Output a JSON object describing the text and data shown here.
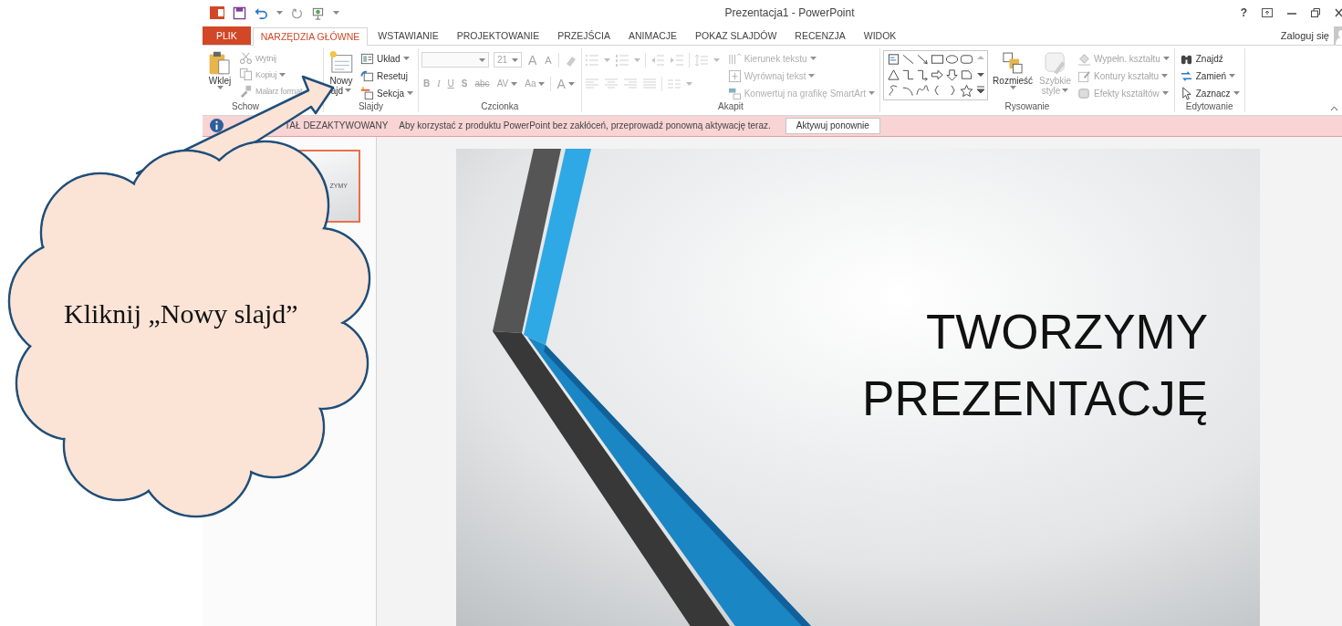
{
  "title_bar": {
    "title": "Prezentacja1 - PowerPoint",
    "help": "?"
  },
  "tabs": [
    {
      "label": "PLIK",
      "kind": "file",
      "selected": false
    },
    {
      "label": "NARZĘDZIA GŁÓWNE",
      "kind": "tab",
      "selected": true
    },
    {
      "label": "WSTAWIANIE",
      "kind": "tab",
      "selected": false
    },
    {
      "label": "PROJEKTOWANIE",
      "kind": "tab",
      "selected": false
    },
    {
      "label": "PRZEJŚCIA",
      "kind": "tab",
      "selected": false
    },
    {
      "label": "ANIMACJE",
      "kind": "tab",
      "selected": false
    },
    {
      "label": "POKAZ SLAJDÓW",
      "kind": "tab",
      "selected": false
    },
    {
      "label": "RECENZJA",
      "kind": "tab",
      "selected": false
    },
    {
      "label": "WIDOK",
      "kind": "tab",
      "selected": false
    }
  ],
  "account": {
    "label": "Zaloguj się"
  },
  "ribbon": {
    "groups": [
      {
        "label": "Schow",
        "kind": "basic",
        "items": [
          {
            "kind": "large",
            "lines": [
              "Wklej"
            ],
            "caret": true,
            "disabled": false
          },
          {
            "kind": "small",
            "lines": [
              "Wytnij"
            ],
            "caret": false,
            "disabled": true
          },
          {
            "kind": "small",
            "lines": [
              "Kopiuj"
            ],
            "caret": true,
            "disabled": true
          },
          {
            "kind": "small",
            "lines": [
              "Malarz format"
            ],
            "caret": false,
            "disabled": true
          }
        ]
      },
      {
        "label": "Slajdy",
        "kind": "basic",
        "items": [
          {
            "kind": "large",
            "lines": [
              "Nowy",
              "ajd"
            ],
            "caret": true,
            "disabled": false
          },
          {
            "kind": "small",
            "lines": [
              "Układ"
            ],
            "caret": true,
            "disabled": false
          },
          {
            "kind": "small",
            "lines": [
              "Resetuj"
            ],
            "caret": false,
            "disabled": false
          },
          {
            "kind": "small",
            "lines": [
              "Sekcja"
            ],
            "caret": true,
            "disabled": false
          }
        ]
      },
      {
        "label": "Czcionka",
        "kind": "font",
        "disabled": true,
        "font_size": "21",
        "size_buttons": [
          "A",
          "A"
        ],
        "format_buttons": [
          "B",
          "I",
          "U",
          "S",
          "abc",
          "AV",
          "Aa"
        ],
        "color_button": "A"
      },
      {
        "label": "Akapit",
        "kind": "paragraph",
        "disabled": true,
        "items": [
          {
            "kind": "small",
            "lines": [
              "Kierunek tekstu"
            ],
            "caret": true,
            "disabled": true
          },
          {
            "kind": "small",
            "lines": [
              "Wyrównaj tekst"
            ],
            "caret": true,
            "disabled": true
          },
          {
            "kind": "small",
            "lines": [
              "Konwertuj na grafikę SmartArt"
            ],
            "caret": true,
            "disabled": true
          }
        ]
      },
      {
        "label": "Rysowanie",
        "kind": "drawing",
        "items": [
          {
            "kind": "large",
            "lines": [
              "Rozmieść"
            ],
            "caret": true,
            "disabled": false
          },
          {
            "kind": "large",
            "lines": [
              "Szybkie",
              "style"
            ],
            "caret": true,
            "disabled": true
          },
          {
            "kind": "small",
            "lines": [
              "Wypełn. kształtu"
            ],
            "caret": true,
            "disabled": true
          },
          {
            "kind": "small",
            "lines": [
              "Kontury kształtu"
            ],
            "caret": true,
            "disabled": true
          },
          {
            "kind": "small",
            "lines": [
              "Efekty kształtów"
            ],
            "caret": true,
            "disabled": true
          }
        ]
      },
      {
        "label": "Edytowanie",
        "kind": "basic",
        "items": [
          {
            "kind": "small",
            "lines": [
              "Znajdź"
            ],
            "caret": false,
            "disabled": false
          },
          {
            "kind": "small",
            "lines": [
              "Zamień"
            ],
            "caret": true,
            "disabled": false
          },
          {
            "kind": "small",
            "lines": [
              "Zaznacz"
            ],
            "caret": true,
            "disabled": false
          }
        ]
      }
    ]
  },
  "notice": {
    "title": "TAŁ DEZAKTYWOWANY",
    "message": "Aby korzystać z produktu PowerPoint bez zakłóceń, przeprowadź ponowną aktywację teraz.",
    "button": "Aktywuj ponownie"
  },
  "thumbnail": {
    "text": "ZYMY",
    "selected": true
  },
  "slide": {
    "title_lines": [
      "TWORZYMY",
      "PREZENTACJĘ"
    ]
  },
  "callout": {
    "text": "Kliknij „Nowy slajd”"
  }
}
